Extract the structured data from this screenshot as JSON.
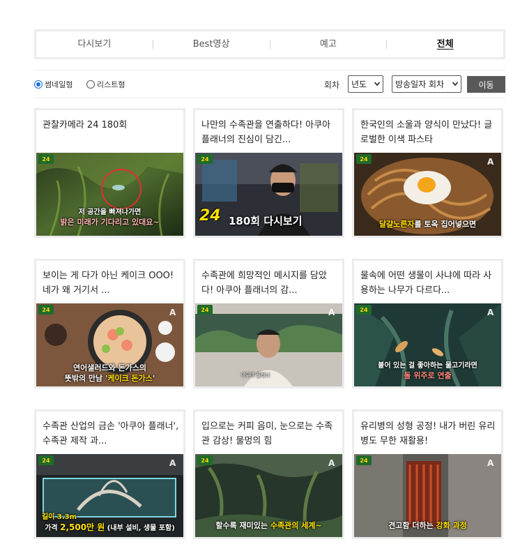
{
  "tabs": [
    {
      "label": "다시보기",
      "active": false
    },
    {
      "label": "Best영상",
      "active": false
    },
    {
      "label": "예고",
      "active": false
    },
    {
      "label": "전체",
      "active": true
    }
  ],
  "view_options": {
    "thumbnail": {
      "label": "썸네일형",
      "checked": true
    },
    "list": {
      "label": "리스트형",
      "checked": false
    }
  },
  "filters": {
    "episode_label": "회차",
    "year_select": "년도",
    "order_select": "방송일자 회차",
    "go_button": "이동"
  },
  "cards": [
    {
      "title": "관찰카메라 24 180회",
      "thumb_badge": "24",
      "caption_line1": "저 공간을 빠져나가면",
      "caption_line2": "밝은 미래가 기다리고 있대요~"
    },
    {
      "title": "나만의 수족관을 연출하다! 아쿠아 플래너의 진심이 담긴...",
      "thumb_badge": "24",
      "caption_main": "180회 다시보기",
      "logo_text": "24"
    },
    {
      "title": "한국인의 소울과 양식이 만났다! 글로벌한 이색 파스타",
      "thumb_badge": "24",
      "caption_pre": "달걀노른자",
      "caption_post": "를 토옥 집어넣으면"
    },
    {
      "title": "보이는 게 다가 아닌 케이크 OOO! 네가 왜 거기서 ...",
      "thumb_badge": "24",
      "caption_line1": "연어샐러드와 돈가스의",
      "caption_line2_pre": "뜻밖의 만남 '",
      "caption_line2_hl": "케이크 돈가스",
      "caption_line2_post": "'"
    },
    {
      "title": "수족관에 희망적인 메시지를 담았다! 아쿠아 플래너의 감...",
      "thumb_badge": "24",
      "caption_small": "아쿠아 플래너"
    },
    {
      "title": "물속에 어떤 생물이 사냐에 따라 사용하는 나무가 다르다...",
      "thumb_badge": "24",
      "caption_line1": "붙어 있는 걸 좋아하는 물고기라면",
      "caption_line2": "돌 위주로 연출"
    },
    {
      "title": "수족관 산업의 금손 '아쿠아 플래너', 수족관 제작 과...",
      "thumb_badge": "24",
      "caption_line1": "길이 3.3m",
      "caption_line2_pre": "가격 ",
      "caption_line2_hl": "2,500만 원",
      "caption_line2_post": " (내부 설비, 생물 포함)"
    },
    {
      "title": "입으로는 커피 음미, 눈으로는 수족관 감상! 물멍의 힘",
      "thumb_badge": "24",
      "caption_pre": "할수록 재미있는 ",
      "caption_hl": "수족관의 세계~"
    },
    {
      "title": "유리병의 성형 공정! 내가 버린 유리병도 무한 재활용!",
      "thumb_badge": "24",
      "caption_pre": "견고함 더하는 ",
      "caption_hl": "강화 과정"
    }
  ],
  "colors": {
    "border": "#ececec",
    "button_bg": "#595959",
    "radio_accent": "#1a6fe0",
    "caption_highlight": "#ffe100"
  }
}
